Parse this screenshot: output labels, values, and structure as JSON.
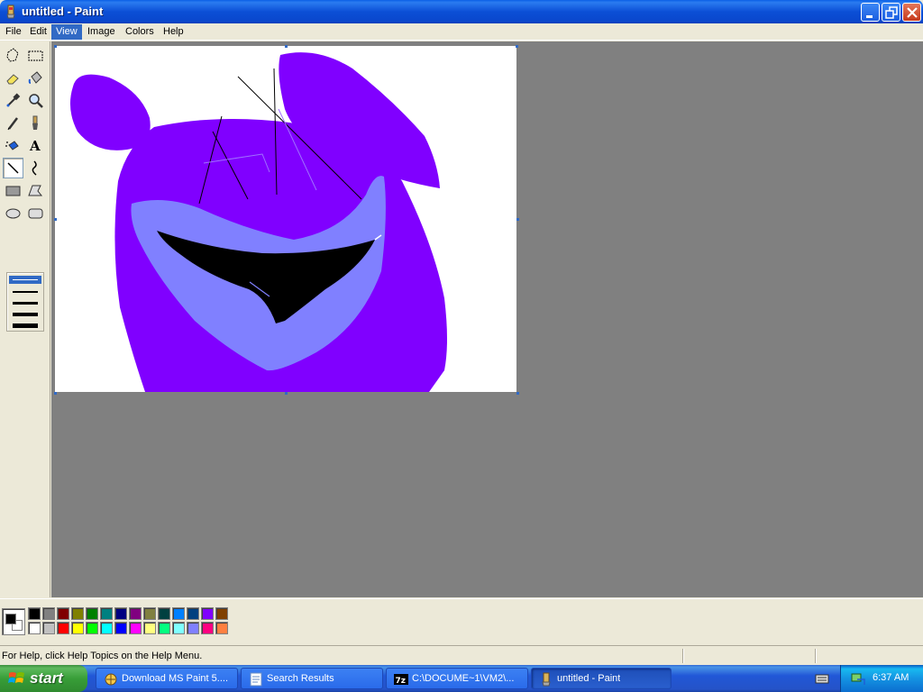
{
  "window": {
    "title": "untitled - Paint"
  },
  "menu": {
    "items": [
      "File",
      "Edit",
      "View",
      "Image",
      "Colors",
      "Help"
    ],
    "active": "View"
  },
  "toolbox": {
    "tools": [
      "free-form-select",
      "select",
      "eraser",
      "fill-with-color",
      "pick-color",
      "magnifier",
      "pencil",
      "brush",
      "airbrush",
      "text",
      "line",
      "curve",
      "rectangle",
      "polygon",
      "ellipse",
      "rounded-rectangle"
    ],
    "selected_tool": "line"
  },
  "palette": {
    "foreground": "#000000",
    "background": "#ffffff",
    "colors_row1": [
      "#000000",
      "#808080",
      "#800000",
      "#808000",
      "#008000",
      "#008080",
      "#000080",
      "#800080",
      "#808040",
      "#004040",
      "#0080ff",
      "#004080",
      "#8000ff",
      "#804000"
    ],
    "colors_row2": [
      "#ffffff",
      "#c0c0c0",
      "#ff0000",
      "#ffff00",
      "#00ff00",
      "#00ffff",
      "#0000ff",
      "#ff00ff",
      "#ffff80",
      "#00ff80",
      "#80ffff",
      "#8080ff",
      "#ff0080",
      "#ff8040"
    ]
  },
  "status": {
    "help_text": "For Help, click Help Topics on the Help Menu."
  },
  "taskbar": {
    "start_label": "start",
    "tasks": [
      {
        "label": "Download MS Paint 5....",
        "icon": "browser-icon"
      },
      {
        "label": "Search Results",
        "icon": "folder-icon"
      },
      {
        "label": "C:\\DOCUME~1\\VM2\\...",
        "icon": "7zip-icon"
      },
      {
        "label": "untitled - Paint",
        "icon": "paint-icon"
      }
    ],
    "clock": "6:37 AM"
  },
  "colors": {
    "drawing_purple": "#8000ff",
    "drawing_lavender": "#8080ff"
  }
}
